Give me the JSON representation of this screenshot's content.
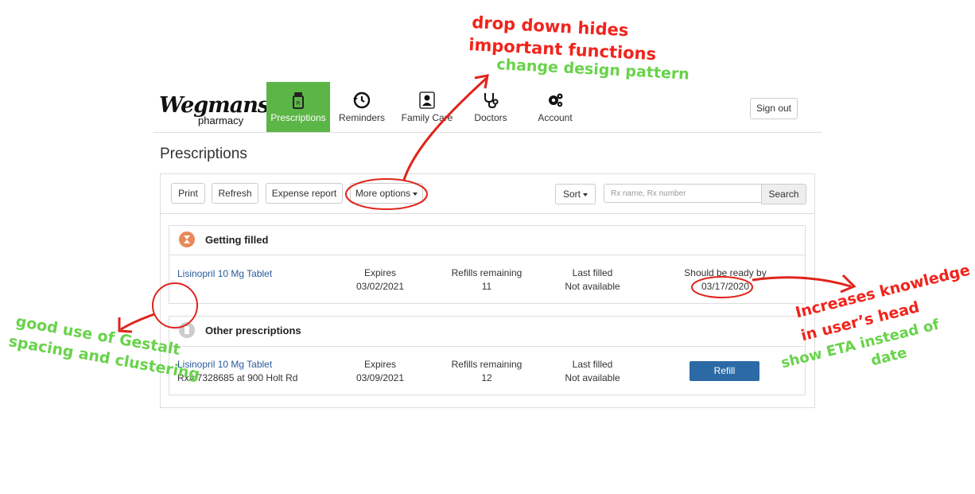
{
  "brand": {
    "name": "Wegmans",
    "sub": "pharmacy"
  },
  "nav": [
    {
      "label": "Prescriptions",
      "icon": "pill-bottle-icon",
      "active": true
    },
    {
      "label": "Reminders",
      "icon": "clock-history-icon",
      "active": false
    },
    {
      "label": "Family Care",
      "icon": "person-card-icon",
      "active": false
    },
    {
      "label": "Doctors",
      "icon": "stethoscope-icon",
      "active": false
    },
    {
      "label": "Account",
      "icon": "gears-icon",
      "active": false
    }
  ],
  "header": {
    "signout_label": "Sign out"
  },
  "page": {
    "title": "Prescriptions"
  },
  "toolbar": {
    "print": "Print",
    "refresh": "Refresh",
    "expense_report": "Expense report",
    "more_options": "More options",
    "sort": "Sort",
    "search_placeholder": "Rx name, Rx number",
    "search_button": "Search"
  },
  "sections": {
    "getting_filled": {
      "title": "Getting filled",
      "row": {
        "name": "Lisinopril 10 Mg Tablet",
        "expires_label": "Expires",
        "expires": "03/02/2021",
        "refills_label": "Refills remaining",
        "refills": "11",
        "last_filled_label": "Last filled",
        "last_filled": "Not available",
        "ready_label": "Should be ready by",
        "ready": "03/17/2020"
      }
    },
    "other": {
      "title": "Other prescriptions",
      "row": {
        "name": "Lisinopril 10 Mg Tablet",
        "rx": "Rx# 7328685 at 900 Holt Rd",
        "expires_label": "Expires",
        "expires": "03/09/2021",
        "refills_label": "Refills remaining",
        "refills": "12",
        "last_filled_label": "Last filled",
        "last_filled": "Not available",
        "refill_button": "Refill"
      }
    }
  },
  "annotations": {
    "dropdown_1": "drop down hides",
    "dropdown_2": "important functions",
    "dropdown_3": "change design pattern",
    "gestalt_1": "good use of Gestalt",
    "gestalt_2": "spacing and clustering",
    "knowledge_1": "Increases knowledge",
    "knowledge_2": "in user’s head",
    "eta_1": "show ETA instead of",
    "eta_2": "date"
  },
  "colors": {
    "accent_green": "#5cb547",
    "link_blue": "#2a5a9a",
    "refill_blue": "#2c6aa6",
    "annotation_red": "#f0241c",
    "annotation_green": "#68d34a",
    "status_orange": "#e8895a"
  }
}
